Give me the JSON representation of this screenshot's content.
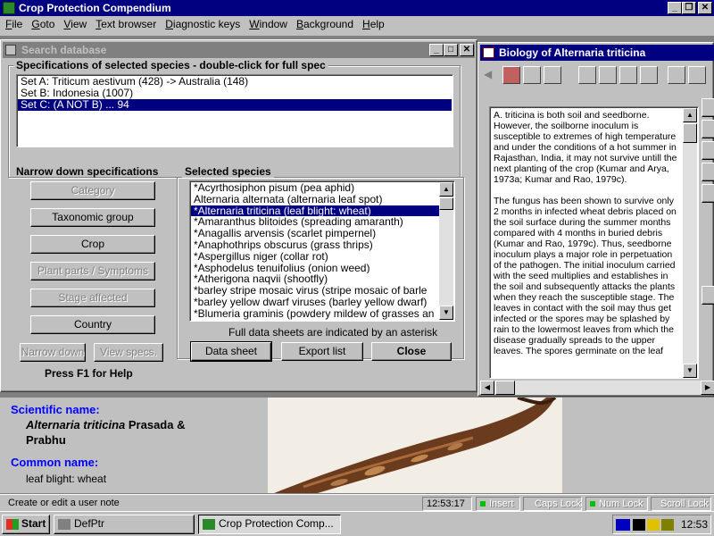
{
  "app": {
    "title": "Crop Protection Compendium"
  },
  "menu": [
    {
      "label": "File",
      "u": "F",
      "rest": "ile"
    },
    {
      "label": "Goto",
      "u": "G",
      "rest": "oto"
    },
    {
      "label": "View",
      "u": "V",
      "rest": "iew"
    },
    {
      "label": "Text browser",
      "u": "T",
      "rest": "ext browser"
    },
    {
      "label": "Diagnostic keys",
      "u": "D",
      "rest": "iagnostic keys"
    },
    {
      "label": "Window",
      "u": "W",
      "rest": "indow"
    },
    {
      "label": "Background",
      "u": "B",
      "rest": "ackground"
    },
    {
      "label": "Help",
      "u": "H",
      "rest": "elp"
    }
  ],
  "search": {
    "title": "Search database",
    "spec_title": "Specifications of selected species - double-click for full spec",
    "specs": [
      "Set A: Triticum aestivum (428) -> Australia (148)",
      "Set B: Indonesia (1007)",
      "Set C: (A NOT B) ... 94"
    ],
    "narrow_title": "Narrow down specifications",
    "narrow_buttons": [
      {
        "label": "Category",
        "disabled": true
      },
      {
        "label": "Taxonomic group",
        "disabled": false
      },
      {
        "label": "Crop",
        "disabled": false
      },
      {
        "label": "Plant parts / Symptoms",
        "disabled": true
      },
      {
        "label": "Stage affected",
        "disabled": true
      },
      {
        "label": "Country",
        "disabled": false
      }
    ],
    "narrow_down_label": "Narrow down",
    "view_specs_label": "View specs.",
    "help_hint": "Press F1 for Help",
    "selected_title": "Selected species",
    "species": [
      "*Acyrthosiphon pisum (pea aphid)",
      " Alternaria alternata (alternaria leaf spot)",
      "*Alternaria triticina (leaf blight: wheat)",
      "*Amaranthus blitoides (spreading amaranth)",
      "*Anagallis arvensis (scarlet pimpernel)",
      "*Anaphothrips obscurus (grass thrips)",
      "*Aspergillus niger (collar rot)",
      "*Asphodelus tenuifolius (onion weed)",
      "*Atherigona naqvii (shootfly)",
      "*barley stripe mosaic virus (stripe mosaic of barle",
      "*barley yellow dwarf viruses (barley yellow dwarf)",
      "*Blumeria graminis (powdery mildew of grasses an"
    ],
    "asterisk_note": "Full data sheets are indicated by an asterisk",
    "data_sheet_label": "Data sheet",
    "export_label": "Export list",
    "close_label": "Close"
  },
  "biology": {
    "title": "Biology of Alternaria triticina",
    "paragraphs": [
      "A. triticina is both soil and seedborne. However, the soilborne inoculum is susceptible to extremes of high temperature and under the conditions of a hot summer in Rajasthan, India, it may not survive untill the next planting of the crop (Kumar and Arya, 1973a; Kumar and Rao, 1979c).",
      "The fungus has been shown to survive only 2 months in infected wheat debris placed on the soil surface during the summer months compared with 4 months in buried debris (Kumar and Rao, 1979c). Thus, seedborne inoculum plays a major role in perpetuation of the pathogen. The initial inoculum carried with the seed multiplies and establishes in the soil and subsequently attacks the plants when they reach the susceptible stage. The leaves in contact with the soil may thus get infected or the spores may be splashed by rain to the lowermost leaves from which the disease gradually spreads to the upper leaves. The spores germinate on the leaf"
    ]
  },
  "info": {
    "sci_label": "Scientific name:",
    "sci_genus": "Alternaria triticina",
    "sci_author": " Prasada & Prabhu",
    "common_label": "Common name:",
    "common_value": "leaf blight: wheat"
  },
  "status": {
    "message": "Create or edit a user note",
    "time": "12:53:17",
    "insert": "Insert",
    "caps": "Caps Lock",
    "num": "Num Lock",
    "scroll": "Scroll Lock"
  },
  "taskbar": {
    "start": "Start",
    "tasks": [
      "DefPtr",
      "Crop Protection Comp..."
    ],
    "clock": "12:53"
  },
  "colors": {
    "title_active": "#000080",
    "title_inactive": "#808080",
    "selection": "#000080",
    "label_blue": "#0000ff"
  }
}
